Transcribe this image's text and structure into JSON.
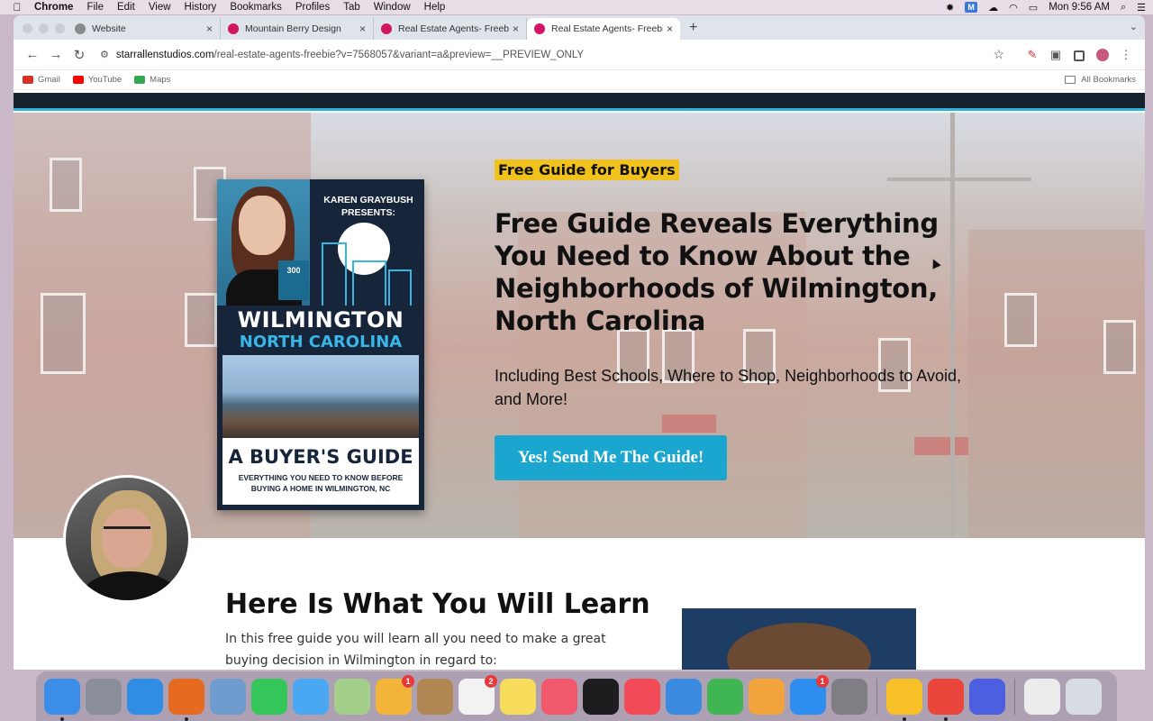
{
  "menubar": {
    "apple_glyph": "",
    "items": [
      "Chrome",
      "File",
      "Edit",
      "View",
      "History",
      "Bookmarks",
      "Profiles",
      "Tab",
      "Window",
      "Help"
    ],
    "clock": "Mon 9:56 AM"
  },
  "browser": {
    "tabs": [
      {
        "label": "Website",
        "favicon_color": "#8a8a8a",
        "active": false
      },
      {
        "label": "Mountain Berry Design",
        "favicon_color": "#d1155f",
        "active": false
      },
      {
        "label": "Real Estate Agents- Freebie",
        "favicon_color": "#d1155f",
        "active": false
      },
      {
        "label": "Real Estate Agents- Freebie",
        "favicon_color": "#d1155f",
        "active": true
      }
    ],
    "url_domain": "starrallenstudios.com",
    "url_path": "/real-estate-agents-freebie?v=7568057&variant=a&preview=__PREVIEW_ONLY",
    "bookmarks": [
      {
        "label": "Gmail",
        "color": "#d93025"
      },
      {
        "label": "YouTube",
        "color": "#ff0000"
      },
      {
        "label": "Maps",
        "color": "#34a853"
      }
    ],
    "all_bookmarks_label": "All Bookmarks"
  },
  "hero": {
    "badge": "Free Guide for Buyers",
    "headline": "Free Guide Reveals Everything You Need to Know About the Neighborhoods of Wilmington, North Carolina",
    "subheadline": "Including Best Schools, Where to Shop, Neighborhoods to Avoid, and More!",
    "cta_label": "Yes! Send Me The Guide!"
  },
  "book": {
    "presenter": "KAREN GRAYBUSH PRESENTS:",
    "award": "300",
    "city": "WILMINGTON",
    "state": "NORTH CAROLINA",
    "title": "A BUYER'S GUIDE",
    "subtitle": "EVERYTHING YOU NEED TO KNOW BEFORE BUYING A HOME IN WILMINGTON, NC"
  },
  "learn": {
    "title": "Here Is What You Will Learn",
    "text": "In this free guide you will learn all you need to make a great buying decision in Wilmington in regard to:"
  },
  "dock": {
    "apps": [
      {
        "name": "Finder",
        "color": "#3b8ee8",
        "running": true
      },
      {
        "name": "Launchpad",
        "color": "#8a8f99",
        "running": false
      },
      {
        "name": "Safari",
        "color": "#2f8de4",
        "running": false
      },
      {
        "name": "Firefox",
        "color": "#e66a1f",
        "running": true
      },
      {
        "name": "Preview",
        "color": "#6f9ccf",
        "running": false
      },
      {
        "name": "FaceTime",
        "color": "#35c759",
        "running": false
      },
      {
        "name": "Messages",
        "color": "#4aa7f2",
        "running": false
      },
      {
        "name": "Maps",
        "color": "#a3cf8a",
        "running": false
      },
      {
        "name": "Photos",
        "color": "#f3b43a",
        "running": false,
        "badge": "1"
      },
      {
        "name": "Contacts",
        "color": "#b08652",
        "running": false
      },
      {
        "name": "Reminders",
        "color": "#f2f2f2",
        "running": false,
        "badge": "2"
      },
      {
        "name": "Notes",
        "color": "#f8dc5c",
        "running": false
      },
      {
        "name": "Music",
        "color": "#f2586b",
        "running": false
      },
      {
        "name": "TV",
        "color": "#1d1d1f",
        "running": false
      },
      {
        "name": "News",
        "color": "#f24a57",
        "running": false
      },
      {
        "name": "Keynote",
        "color": "#3a8be0",
        "running": false
      },
      {
        "name": "Numbers",
        "color": "#3fb653",
        "running": false
      },
      {
        "name": "Pages",
        "color": "#f3a33b",
        "running": false
      },
      {
        "name": "App Store",
        "color": "#2d8ef0",
        "running": false,
        "badge": "1"
      },
      {
        "name": "System Settings",
        "color": "#7e7e84",
        "running": false
      },
      {
        "name": "Slides",
        "color": "#f6c026",
        "running": true
      },
      {
        "name": "Chrome",
        "color": "#e9453a",
        "running": true
      },
      {
        "name": "Perplexity",
        "color": "#4b5fe0",
        "running": false
      }
    ]
  }
}
